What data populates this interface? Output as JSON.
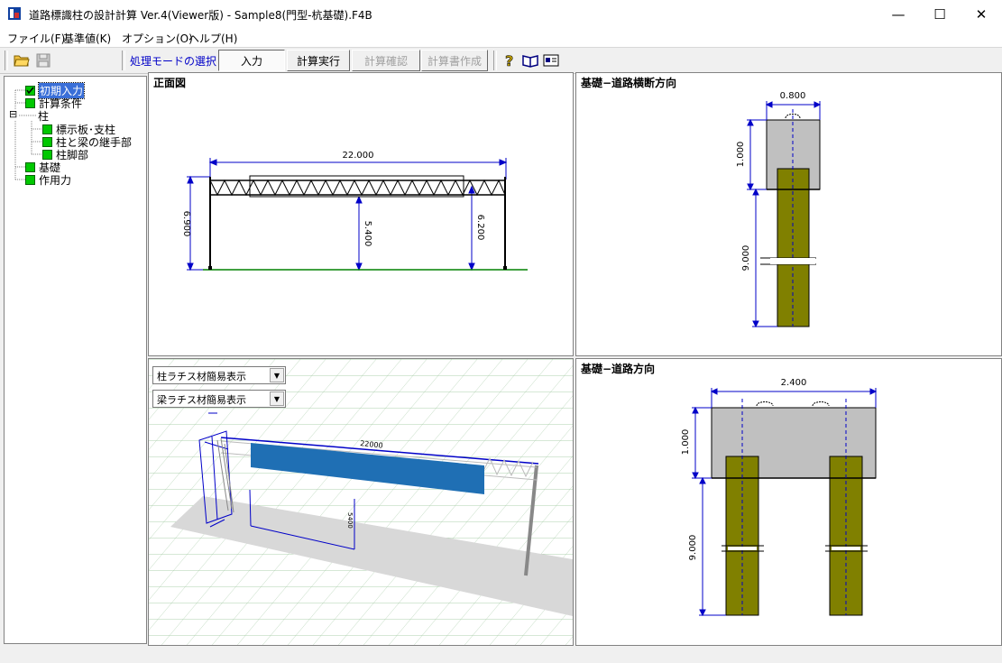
{
  "window": {
    "title": "道路標識柱の設計計算 Ver.4(Viewer版) - Sample8(門型-杭基礎).F4B",
    "minimize": "—",
    "maximize": "☐",
    "close": "✕"
  },
  "menu": [
    "ファイル(F)",
    "基準値(K)",
    "オプション(O)",
    "ヘルプ(H)"
  ],
  "toolbar": {
    "mode_label": "処理モードの選択",
    "buttons": [
      "入力",
      "計算実行",
      "計算確認",
      "計算書作成"
    ],
    "help_icon": "question-icon",
    "book_icon": "book-icon",
    "card_icon": "card-icon"
  },
  "tree": {
    "items": [
      "初期入力",
      "計算条件",
      "柱",
      "標示板･支柱",
      "柱と梁の継手部",
      "柱脚部",
      "基礎",
      "作用力"
    ],
    "expander": "⊟"
  },
  "panels": {
    "front": {
      "title": "正面図",
      "dims": {
        "span": "22.000",
        "left_height": "6.900",
        "center_height": "5.400",
        "right_height": "6.200"
      }
    },
    "cross": {
      "title": "基礎−道路横断方向",
      "dims": {
        "width": "0.800",
        "depth": "1.000",
        "pile": "9.000"
      }
    },
    "view3d": {
      "combo1": "柱ラチス材簡易表示",
      "combo2": "梁ラチス材簡易表示",
      "labels": {
        "span": "22000",
        "height": "5400"
      }
    },
    "road": {
      "title": "基礎−道路方向",
      "dims": {
        "width": "2.400",
        "depth": "1.000",
        "pile": "9.000"
      }
    }
  },
  "colors": {
    "accent": "#0000c8",
    "pile": "#808000",
    "footing": "#c0c0c0",
    "ground": "#008000",
    "sign": "#1f6fb4"
  }
}
